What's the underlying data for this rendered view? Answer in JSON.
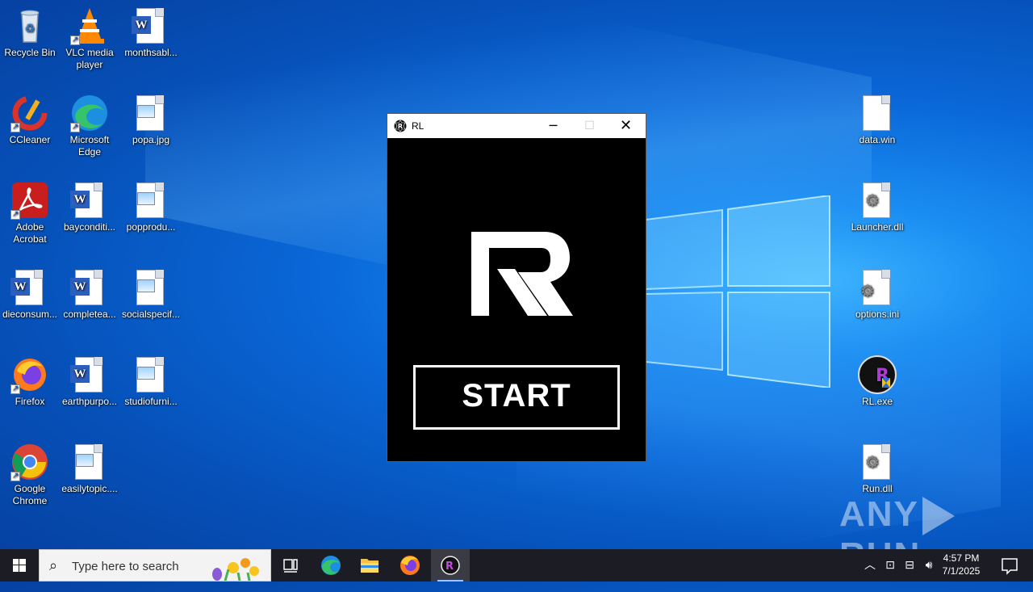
{
  "desktop": {
    "icons": [
      {
        "label": "Recycle Bin"
      },
      {
        "label": "VLC media player"
      },
      {
        "label": "monthsabl..."
      },
      {
        "label": "CCleaner"
      },
      {
        "label": "Microsoft Edge"
      },
      {
        "label": "popa.jpg"
      },
      {
        "label": "Adobe Acrobat"
      },
      {
        "label": "bayconditi..."
      },
      {
        "label": "popprodu..."
      },
      {
        "label": "dieconsum..."
      },
      {
        "label": "completea..."
      },
      {
        "label": "socialspecif..."
      },
      {
        "label": "Firefox"
      },
      {
        "label": "earthpurpo..."
      },
      {
        "label": "studiofurni..."
      },
      {
        "label": "Google Chrome"
      },
      {
        "label": "easilytopic...."
      },
      {
        "label": "data.win"
      },
      {
        "label": "Launcher.dll"
      },
      {
        "label": "options.ini"
      },
      {
        "label": "RL.exe"
      },
      {
        "label": "Run.dll"
      }
    ]
  },
  "window": {
    "title": "RL",
    "minimize_icon": "minimize-icon",
    "maximize_icon": "maximize-icon",
    "close_icon": "close-icon",
    "start_label": "START",
    "logo_text": "R"
  },
  "watermark": {
    "left": "ANY",
    "right": "RUN"
  },
  "taskbar": {
    "search_placeholder": "Type here to search",
    "time": "4:57 PM",
    "date": "7/1/2025"
  },
  "colors": {
    "taskbar_bg": "#1c1c24",
    "window_bg": "#000000",
    "desktop_accent": "#0a68d8"
  }
}
